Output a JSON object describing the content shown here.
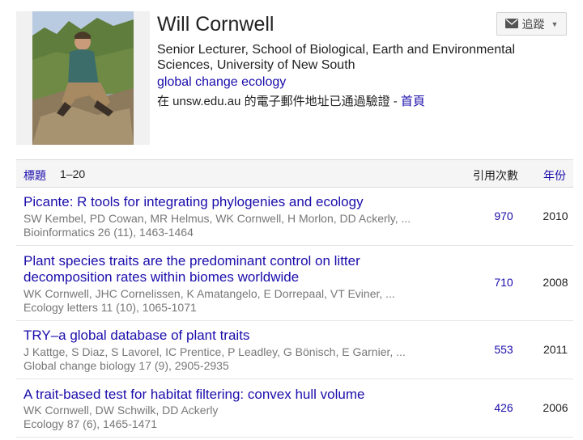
{
  "profile": {
    "name": "Will Cornwell",
    "affiliation": "Senior Lecturer, School of Biological, Earth and Environmental Sciences, University of New South",
    "interest": "global change ecology",
    "verified_text": "在 unsw.edu.au 的電子郵件地址已通過驗證 - ",
    "homepage_label": "首頁",
    "follow_label": "追蹤"
  },
  "table": {
    "title_col": "標題",
    "range": "1–20",
    "cites_col": "引用次數",
    "year_col": "年份"
  },
  "articles": [
    {
      "title": "Picante: R tools for integrating phylogenies and ecology",
      "authors": "SW Kembel, PD Cowan, MR Helmus, WK Cornwell, H Morlon, DD Ackerly, ...",
      "venue": "Bioinformatics 26 (11), 1463-1464",
      "cites": "970",
      "year": "2010"
    },
    {
      "title": "Plant species traits are the predominant control on litter decomposition rates within biomes worldwide",
      "authors": "WK Cornwell, JHC Cornelissen, K Amatangelo, E Dorrepaal, VT Eviner, ...",
      "venue": "Ecology letters 11 (10), 1065-1071",
      "cites": "710",
      "year": "2008"
    },
    {
      "title": "TRY–a global database of plant traits",
      "authors": "J Kattge, S Diaz, S Lavorel, IC Prentice, P Leadley, G Bönisch, E Garnier, ...",
      "venue": "Global change biology 17 (9), 2905-2935",
      "cites": "553",
      "year": "2011"
    },
    {
      "title": "A trait-based test for habitat filtering: convex hull volume",
      "authors": "WK Cornwell, DW Schwilk, DD Ackerly",
      "venue": "Ecology 87 (6), 1465-1471",
      "cites": "426",
      "year": "2006"
    }
  ]
}
